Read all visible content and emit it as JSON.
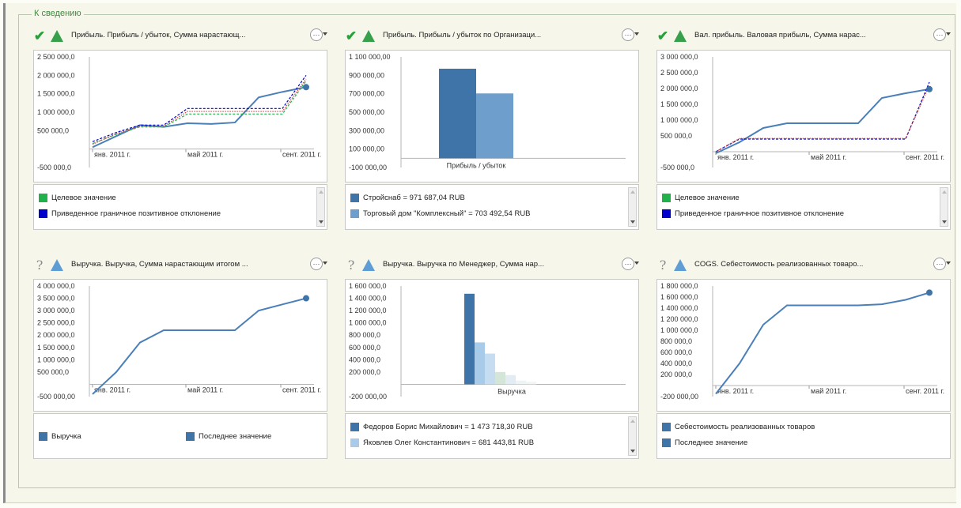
{
  "group": {
    "legend": "К сведению"
  },
  "colors": {
    "accent_green": "#27a13a",
    "line_blue": "#4a7fb8",
    "target_green": "#21b14a",
    "threshold_blue": "#0000cc"
  },
  "panels": [
    {
      "status": "ok",
      "status_icon": "checkmark-icon",
      "indicator_icon": "green-triangle-icon",
      "title": "Прибыль. Прибыль / убыток, Сумма нарастающ...",
      "legend": [
        {
          "label": "Целевое значение",
          "color": "#21b14a"
        },
        {
          "label": "Приведенное граничное позитивное отклонение",
          "color": "#0000cc"
        }
      ],
      "legend_scroll": true
    },
    {
      "status": "ok",
      "status_icon": "checkmark-icon",
      "indicator_icon": "green-triangle-icon",
      "title": "Прибыль. Прибыль / убыток по Организаци...",
      "legend": [
        {
          "label": "Стройснаб = 971 687,04 RUB",
          "color": "#3e74a8"
        },
        {
          "label": "Торговый дом \"Комплексный\" = 703 492,54 RUB",
          "color": "#6e9ecb"
        }
      ],
      "legend_scroll": true
    },
    {
      "status": "ok",
      "status_icon": "checkmark-icon",
      "indicator_icon": "green-triangle-icon",
      "title": "Вал. прибыль. Валовая прибыль, Сумма нарас...",
      "legend": [
        {
          "label": "Целевое значение",
          "color": "#21b14a"
        },
        {
          "label": "Приведенное граничное позитивное отклонение",
          "color": "#0000cc"
        }
      ],
      "legend_scroll": true
    },
    {
      "status": "unknown",
      "status_icon": "question-icon",
      "indicator_icon": "blue-triangle-icon",
      "title": "Выручка. Выручка, Сумма нарастающим итогом ...",
      "legend": [
        {
          "label": "Выручка",
          "color": "#3e74a8"
        },
        {
          "label": "Последнее значение",
          "color": "#3e74a8"
        }
      ],
      "legend_scroll": false
    },
    {
      "status": "unknown",
      "status_icon": "question-icon",
      "indicator_icon": "blue-triangle-icon",
      "title": "Выручка. Выручка по Менеджер, Сумма нар...",
      "legend": [
        {
          "label": "Федоров Борис Михайлович = 1 473 718,30 RUB",
          "color": "#3e74a8"
        },
        {
          "label": "Яковлев Олег Константинович = 681 443,81 RUB",
          "color": "#a9cbea"
        }
      ],
      "legend_scroll": true
    },
    {
      "status": "unknown",
      "status_icon": "question-icon",
      "indicator_icon": "blue-triangle-icon",
      "title": "COGS. Себестоимость реализованных товаро...",
      "legend": [
        {
          "label": "Себестоимость реализованных товаров",
          "color": "#3e74a8"
        },
        {
          "label": "Последнее значение",
          "color": "#3e74a8"
        }
      ],
      "legend_scroll": false
    }
  ],
  "chart_data": [
    {
      "type": "line",
      "yticks": [
        "2 500 000,0",
        "2 000 000,0",
        "1 500 000,0",
        "1 000 000,0",
        "500 000,0",
        "-500 000,0"
      ],
      "ytick_values": [
        2500000,
        2000000,
        1500000,
        1000000,
        500000,
        -500000
      ],
      "ylim": [
        -500000,
        2500000
      ],
      "xticks": [
        "янв. 2011 г.",
        "май 2011 г.",
        "сент. 2011 г."
      ],
      "x_months": [
        0,
        1,
        2,
        3,
        4,
        5,
        6,
        7,
        8,
        9
      ],
      "series": [
        {
          "values": [
            50000,
            350000,
            650000,
            600000,
            700000,
            680000,
            720000,
            1400000,
            1550000,
            1680000
          ],
          "color": "#4a7fb8",
          "style": "solid"
        },
        {
          "values": [
            150000,
            400000,
            600000,
            600000,
            950000,
            950000,
            950000,
            950000,
            950000,
            1850000
          ],
          "color": "#21b14a",
          "style": "dashed"
        },
        {
          "values": [
            200000,
            450000,
            650000,
            650000,
            1100000,
            1100000,
            1100000,
            1100000,
            1100000,
            2000000
          ],
          "color": "#0000cc",
          "style": "dashed"
        },
        {
          "values": [
            130000,
            420000,
            620000,
            620000,
            1020000,
            1020000,
            1020000,
            1020000,
            1020000,
            1900000
          ],
          "color": "#d04040",
          "style": "dotted"
        }
      ],
      "marker_last": true
    },
    {
      "type": "bar",
      "yticks": [
        "1 100 000,00",
        "900 000,00",
        "700 000,00",
        "500 000,00",
        "300 000,00",
        "100 000,00",
        "-100 000,00"
      ],
      "ytick_values": [
        1100000,
        900000,
        700000,
        500000,
        300000,
        100000,
        -100000
      ],
      "ylim": [
        -100000,
        1100000
      ],
      "categories": [
        "Прибыль / убыток"
      ],
      "series": [
        {
          "values": [
            971687.04
          ],
          "color": "#3e74a8"
        },
        {
          "values": [
            703492.54
          ],
          "color": "#6e9ecb"
        }
      ]
    },
    {
      "type": "line",
      "yticks": [
        "3 000 000,0",
        "2 500 000,0",
        "2 000 000,0",
        "1 500 000,0",
        "1 000 000,0",
        "500 000,0",
        "-500 000,0"
      ],
      "ytick_values": [
        3000000,
        2500000,
        2000000,
        1500000,
        1000000,
        500000,
        -500000
      ],
      "ylim": [
        -500000,
        3000000
      ],
      "xticks": [
        "янв. 2011 г.",
        "май 2011 г.",
        "сент. 2011 г."
      ],
      "x_months": [
        0,
        1,
        2,
        3,
        4,
        5,
        6,
        7,
        8,
        9
      ],
      "series": [
        {
          "values": [
            -50000,
            300000,
            750000,
            900000,
            900000,
            900000,
            900000,
            1700000,
            1850000,
            1980000
          ],
          "color": "#4a7fb8",
          "style": "solid"
        },
        {
          "values": [
            0,
            400000,
            400000,
            400000,
            400000,
            400000,
            400000,
            400000,
            400000,
            2200000
          ],
          "color": "#0000cc",
          "style": "dashed"
        },
        {
          "values": [
            0,
            420000,
            420000,
            420000,
            420000,
            420000,
            420000,
            420000,
            420000,
            2100000
          ],
          "color": "#d04040",
          "style": "dotted"
        }
      ],
      "marker_last": true
    },
    {
      "type": "line",
      "yticks": [
        "4 000 000,0",
        "3 500 000,0",
        "3 000 000,0",
        "2 500 000,0",
        "2 000 000,0",
        "1 500 000,0",
        "1 000 000,0",
        "500 000,0",
        "-500 000,00"
      ],
      "ytick_values": [
        4000000,
        3500000,
        3000000,
        2500000,
        2000000,
        1500000,
        1000000,
        500000,
        -500000
      ],
      "ylim": [
        -500000,
        4000000
      ],
      "xticks": [
        "янв. 2011 г.",
        "май 2011 г.",
        "сент. 2011 г."
      ],
      "x_months": [
        0,
        1,
        2,
        3,
        4,
        5,
        6,
        7,
        8,
        9
      ],
      "series": [
        {
          "values": [
            -400000,
            500000,
            1700000,
            2200000,
            2200000,
            2200000,
            2200000,
            3000000,
            3250000,
            3500000
          ],
          "color": "#4a7fb8",
          "style": "solid"
        }
      ],
      "marker_last": true
    },
    {
      "type": "bar",
      "yticks": [
        "1 600 000,0",
        "1 400 000,0",
        "1 200 000,0",
        "1 000 000,0",
        "800 000,0",
        "600 000,0",
        "400 000,0",
        "200 000,0",
        "-200 000,00"
      ],
      "ytick_values": [
        1600000,
        1400000,
        1200000,
        1000000,
        800000,
        600000,
        400000,
        200000,
        -200000
      ],
      "ylim": [
        -200000,
        1600000
      ],
      "categories": [
        "Выручка"
      ],
      "series": [
        {
          "values": [
            1473718.3
          ],
          "color": "#3e74a8"
        },
        {
          "values": [
            681443.81
          ],
          "color": "#a9cbea"
        },
        {
          "values": [
            500000
          ],
          "color": "#c6dcf0"
        },
        {
          "values": [
            200000
          ],
          "color": "#d4e6d8"
        },
        {
          "values": [
            150000
          ],
          "color": "#e2ecf2"
        },
        {
          "values": [
            60000
          ],
          "color": "#eef3f5"
        },
        {
          "values": [
            40000
          ],
          "color": "#f1f5f5"
        }
      ]
    },
    {
      "type": "line",
      "yticks": [
        "1 800 000,0",
        "1 600 000,0",
        "1 400 000,0",
        "1 200 000,0",
        "1 000 000,0",
        "800 000,0",
        "600 000,0",
        "400 000,0",
        "200 000,0",
        "-200 000,00"
      ],
      "ytick_values": [
        1800000,
        1600000,
        1400000,
        1200000,
        1000000,
        800000,
        600000,
        400000,
        200000,
        -200000
      ],
      "ylim": [
        -200000,
        1800000
      ],
      "xticks": [
        "янв. 2011 г.",
        "май 2011 г.",
        "сент. 2011 г."
      ],
      "x_months": [
        0,
        1,
        2,
        3,
        4,
        5,
        6,
        7,
        8,
        9
      ],
      "series": [
        {
          "values": [
            -150000,
            400000,
            1100000,
            1450000,
            1450000,
            1450000,
            1450000,
            1470000,
            1550000,
            1680000
          ],
          "color": "#4a7fb8",
          "style": "solid"
        }
      ],
      "marker_last": true
    }
  ]
}
